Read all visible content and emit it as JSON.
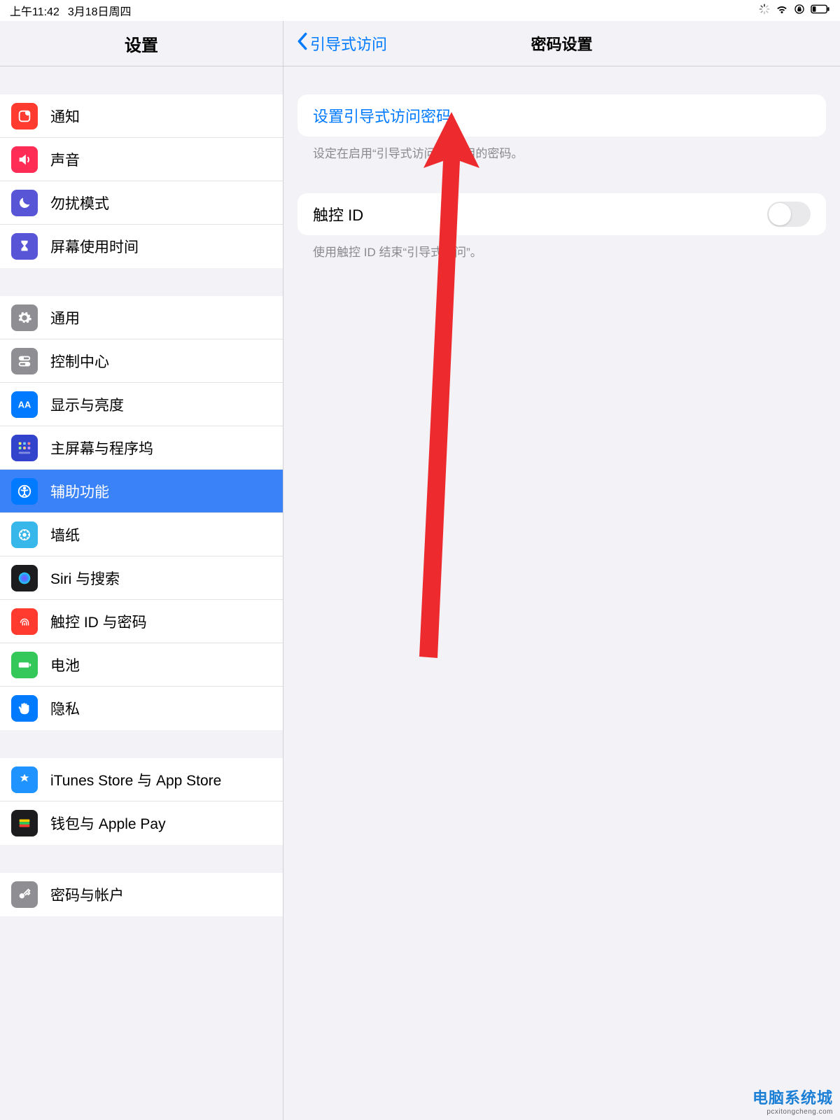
{
  "status": {
    "time": "上午11:42",
    "date": "3月18日周四"
  },
  "sidebar": {
    "title": "设置",
    "groups": [
      [
        {
          "label": "通知",
          "icon": "notifications",
          "bg": "#ff3b30"
        },
        {
          "label": "声音",
          "icon": "sound",
          "bg": "#ff2d55"
        },
        {
          "label": "勿扰模式",
          "icon": "moon",
          "bg": "#5856d6"
        },
        {
          "label": "屏幕使用时间",
          "icon": "hourglass",
          "bg": "#5856d6"
        }
      ],
      [
        {
          "label": "通用",
          "icon": "gear",
          "bg": "#8e8e93"
        },
        {
          "label": "控制中心",
          "icon": "switches",
          "bg": "#8e8e93"
        },
        {
          "label": "显示与亮度",
          "icon": "aa",
          "bg": "#007aff"
        },
        {
          "label": "主屏幕与程序坞",
          "icon": "grid",
          "bg": "#3355dd"
        },
        {
          "label": "辅助功能",
          "icon": "accessibility",
          "bg": "#007aff",
          "selected": true
        },
        {
          "label": "墙纸",
          "icon": "wallpaper",
          "bg": "#38b7ea"
        },
        {
          "label": "Siri 与搜索",
          "icon": "siri",
          "bg": "#1c1c1e"
        },
        {
          "label": "触控 ID 与密码",
          "icon": "touchid",
          "bg": "#ff3b30"
        },
        {
          "label": "电池",
          "icon": "battery",
          "bg": "#34c759"
        },
        {
          "label": "隐私",
          "icon": "hand",
          "bg": "#007aff"
        }
      ],
      [
        {
          "label": "iTunes Store 与 App Store",
          "icon": "appstore",
          "bg": "#1f93ff"
        },
        {
          "label": "钱包与 Apple Pay",
          "icon": "wallet",
          "bg": "#1c1c1e"
        }
      ],
      [
        {
          "label": "密码与帐户",
          "icon": "key",
          "bg": "#8e8e93"
        }
      ]
    ]
  },
  "detail": {
    "back": "引导式访问",
    "title": "密码设置",
    "set_passcode": "设置引导式访问密码",
    "set_passcode_caption": "设定在启用“引导式访问”时使用的密码。",
    "touchid_label": "触控 ID",
    "touchid_caption": "使用触控 ID 结束“引导式访问”。"
  },
  "watermark": {
    "line1": "电脑系统城",
    "line2": "pcxitongcheng.com"
  }
}
